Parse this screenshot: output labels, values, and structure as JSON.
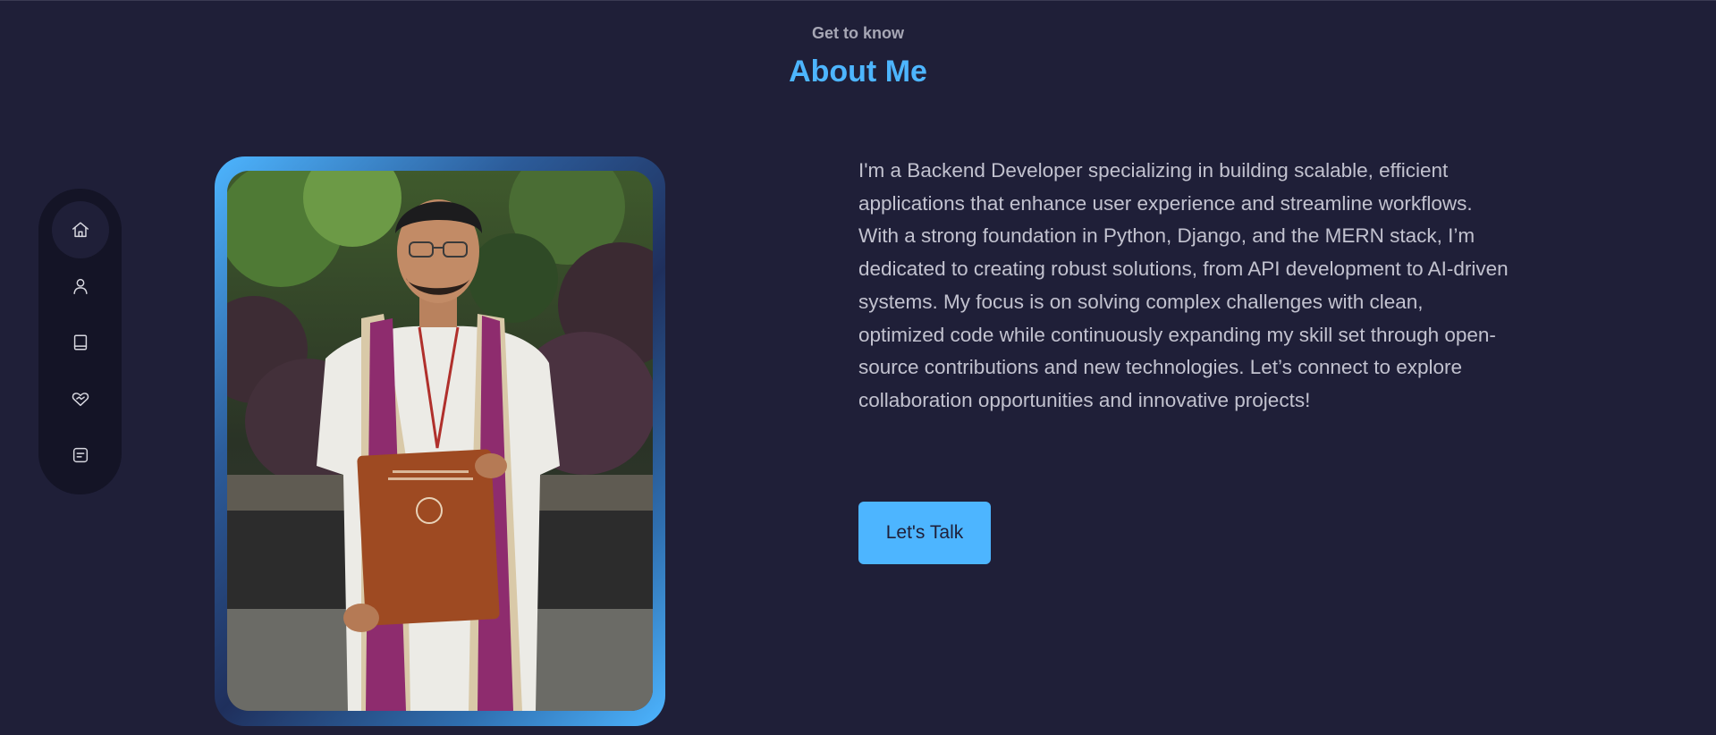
{
  "header": {
    "eyebrow": "Get to know",
    "title": "About Me"
  },
  "nav": {
    "items": [
      {
        "icon": "home-icon",
        "active": true
      },
      {
        "icon": "user-icon",
        "active": false
      },
      {
        "icon": "book-icon",
        "active": false
      },
      {
        "icon": "heart-handshake-icon",
        "active": false
      },
      {
        "icon": "message-icon",
        "active": false
      }
    ]
  },
  "about": {
    "photo_alt": "Graduate holding degree folder at IIIT Surat",
    "bio": "I'm a Backend Developer specializing in building scalable, efficient applications that enhance user experience and streamline workflows. With a strong foundation in Python, Django, and the MERN stack, I’m dedicated to creating robust solutions, from API development to AI-driven systems. My focus is on solving complex challenges with clean, optimized code while continuously expanding my skill set through open-source contributions and new technologies. Let’s connect to explore collaboration opportunities and innovative projects!",
    "cta_label": "Let's Talk"
  },
  "colors": {
    "background": "#1f1f38",
    "accent": "#4db5ff",
    "nav_bg": "#141426",
    "text": "#c2c2cf"
  }
}
